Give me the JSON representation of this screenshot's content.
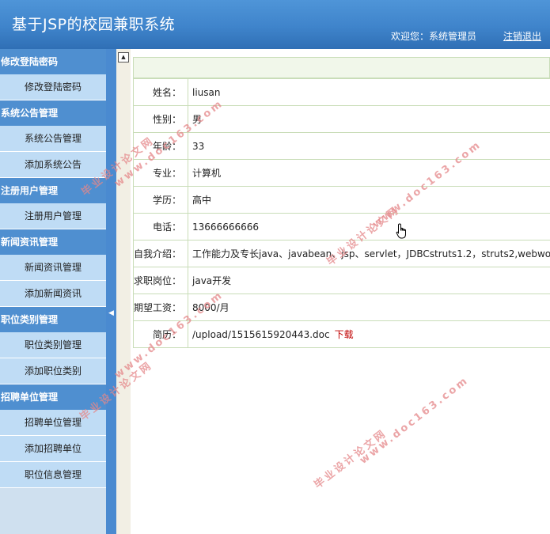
{
  "header": {
    "title": "基于JSP的校园兼职系统",
    "welcome": "欢迎您：系统管理员",
    "logout": "注销退出"
  },
  "sidebar": {
    "groups": [
      {
        "label": "修改登陆密码",
        "items": [
          "修改登陆密码"
        ]
      },
      {
        "label": "系统公告管理",
        "items": [
          "系统公告管理",
          "添加系统公告"
        ]
      },
      {
        "label": "注册用户管理",
        "items": [
          "注册用户管理"
        ]
      },
      {
        "label": "新闻资讯管理",
        "items": [
          "新闻资讯管理",
          "添加新闻资讯"
        ]
      },
      {
        "label": "职位类别管理",
        "items": [
          "职位类别管理",
          "添加职位类别"
        ]
      },
      {
        "label": "招聘单位管理",
        "items": [
          "招聘单位管理",
          "添加招聘单位",
          "职位信息管理"
        ]
      }
    ]
  },
  "detail": {
    "rows": [
      {
        "label": "姓名：",
        "value": "liusan"
      },
      {
        "label": "性别：",
        "value": "男"
      },
      {
        "label": "年龄：",
        "value": "33"
      },
      {
        "label": "专业：",
        "value": "计算机"
      },
      {
        "label": "学历：",
        "value": "高中"
      },
      {
        "label": "电话：",
        "value": "13666666666"
      },
      {
        "label": "自我介绍：",
        "value": "工作能力及专长java、javabean、jsp、servlet，JDBCstruts1.2，struts2,webwo"
      },
      {
        "label": "求职岗位：",
        "value": "java开发"
      },
      {
        "label": "期望工资：",
        "value": "8000/月"
      },
      {
        "label": "简历：",
        "value": "/upload/1515615920443.doc"
      }
    ],
    "download_label": "下载"
  },
  "watermark": {
    "line1": "毕业设计论文网",
    "line2": "www.doc163.com"
  },
  "colors": {
    "header": "#3f84cb",
    "menu_group": "#4f8fd0",
    "menu_item": "#bfdcf5",
    "table_border": "#c9ddb8",
    "download": "#c00000",
    "watermark": "#e5888a"
  }
}
